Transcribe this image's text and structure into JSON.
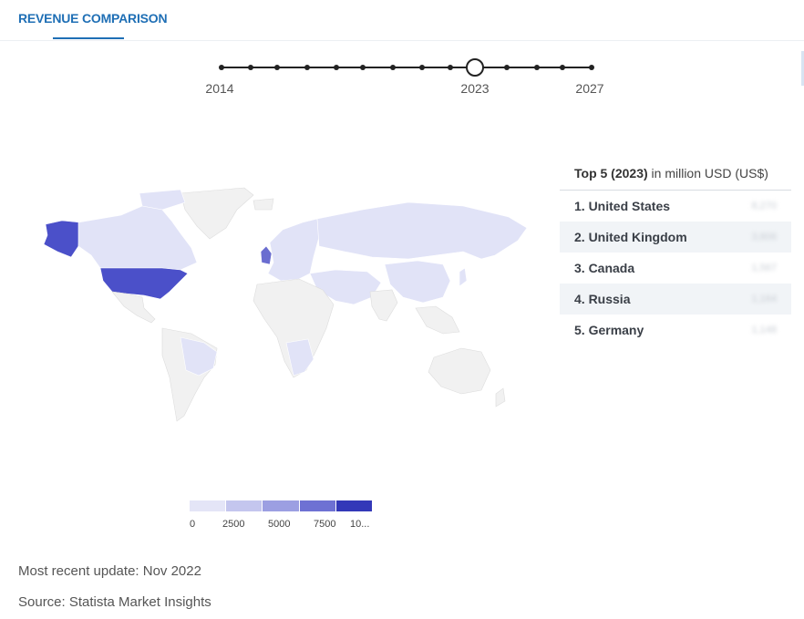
{
  "tabs": {
    "active": "REVENUE COMPARISON"
  },
  "timeline": {
    "start_label": "2014",
    "selected_label": "2023",
    "end_label": "2027"
  },
  "top5": {
    "title_bold": "Top 5 (2023)",
    "title_rest": " in million USD (US$)",
    "rows": [
      {
        "label": "1. United States",
        "value": "8,270"
      },
      {
        "label": "2. United Kingdom",
        "value": "3,806"
      },
      {
        "label": "3. Canada",
        "value": "1,567"
      },
      {
        "label": "4. Russia",
        "value": "1,164"
      },
      {
        "label": "5. Germany",
        "value": "1,148"
      }
    ]
  },
  "legend": {
    "ticks": [
      "0",
      "2500",
      "5000",
      "7500",
      "10..."
    ],
    "colors": [
      "#e4e5f7",
      "#c4c6ee",
      "#9c9fe2",
      "#6e71d3",
      "#3338b8"
    ]
  },
  "colors": {
    "usa": "#4b50c9",
    "uk": "#6a6dd0",
    "tier_mid": "#c9cbef",
    "tier_low": "#e1e3f7",
    "no_data": "#f1f1f1",
    "accent": "#1f6fb5"
  },
  "footer": {
    "update": "Most recent update: Nov 2022",
    "source": "Source: Statista Market Insights"
  }
}
